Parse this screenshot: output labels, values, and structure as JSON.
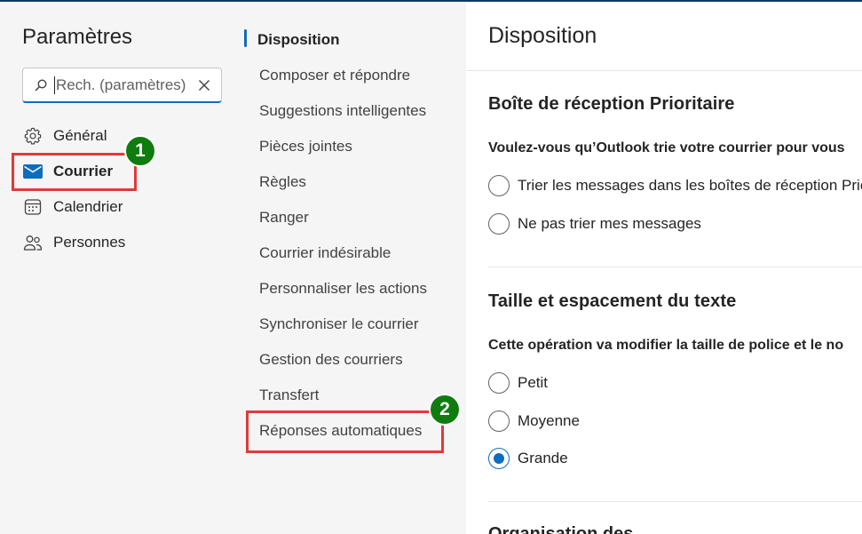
{
  "settings": {
    "title": "Paramètres",
    "search": {
      "placeholder": "Rech. (paramètres)"
    },
    "nav": [
      {
        "label": "Général",
        "icon": "gear-icon"
      },
      {
        "label": "Courrier",
        "icon": "mail-icon",
        "active": true
      },
      {
        "label": "Calendrier",
        "icon": "calendar-icon"
      },
      {
        "label": "Personnes",
        "icon": "people-icon"
      }
    ]
  },
  "mail_nav": {
    "items": [
      {
        "label": "Disposition",
        "active": true
      },
      {
        "label": "Composer et répondre"
      },
      {
        "label": "Suggestions intelligentes"
      },
      {
        "label": "Pièces jointes"
      },
      {
        "label": "Règles"
      },
      {
        "label": "Ranger"
      },
      {
        "label": "Courrier indésirable"
      },
      {
        "label": "Personnaliser les actions"
      },
      {
        "label": "Synchroniser le courrier"
      },
      {
        "label": "Gestion des courriers"
      },
      {
        "label": "Transfert"
      },
      {
        "label": "Réponses automatiques"
      }
    ]
  },
  "annotations": {
    "badge1": "1",
    "badge2": "2"
  },
  "content": {
    "title": "Disposition",
    "focused_inbox": {
      "title": "Boîte de réception Prioritaire",
      "question": "Voulez-vous qu’Outlook trie votre courrier pour vous",
      "options": [
        {
          "label": "Trier les messages dans les boîtes de réception Prio",
          "checked": false
        },
        {
          "label": "Ne pas trier mes messages",
          "checked": false
        }
      ]
    },
    "text_size": {
      "title": "Taille et espacement du texte",
      "question": "Cette opération va modifier la taille de police et le no",
      "options": [
        {
          "label": "Petit",
          "checked": false
        },
        {
          "label": "Moyenne",
          "checked": false
        },
        {
          "label": "Grande",
          "checked": true
        }
      ]
    },
    "next_section_partial": "Organisation des"
  },
  "colors": {
    "accent": "#0f6cbd",
    "annotation_box": "#e03a3a",
    "annotation_badge": "#107c10"
  }
}
